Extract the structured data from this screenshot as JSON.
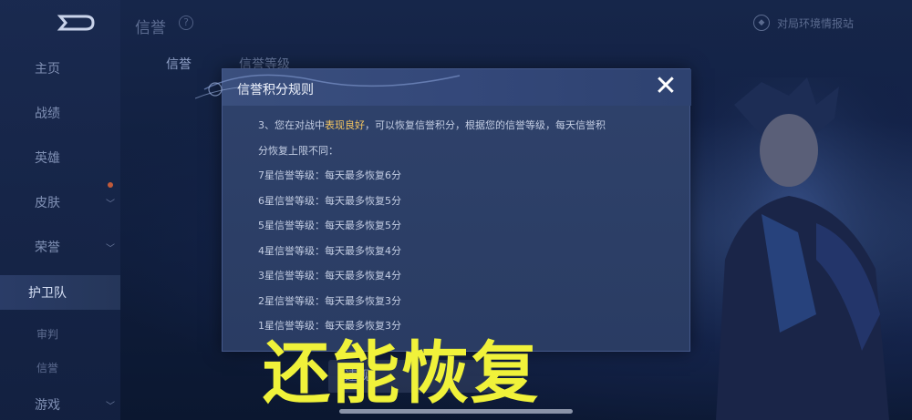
{
  "colors": {
    "accent_highlight": "#f5c660",
    "caption_yellow": "#f0f23a",
    "modal_bg": "#2f426b",
    "page_bg": "#0d1a33"
  },
  "sidebar": {
    "items": [
      {
        "label": "主页",
        "chevron": false,
        "active": false
      },
      {
        "label": "战绩",
        "chevron": false,
        "active": false
      },
      {
        "label": "英雄",
        "chevron": false,
        "active": false
      },
      {
        "label": "皮肤",
        "chevron": true,
        "active": false,
        "dot": true
      },
      {
        "label": "荣誉",
        "chevron": true,
        "active": false
      },
      {
        "label": "护卫队",
        "chevron": false,
        "active": true
      },
      {
        "label": "审判",
        "chevron": false,
        "active": false,
        "sub": true
      },
      {
        "label": "信誉",
        "chevron": false,
        "active": false,
        "sub": true
      },
      {
        "label": "游戏",
        "chevron": true,
        "active": false
      }
    ]
  },
  "header": {
    "title": "信誉",
    "help_icon": "question-circle-icon",
    "report_label": "对局环境情报站",
    "report_icon": "shield-badge-icon"
  },
  "tabs": [
    "信誉",
    "信誉等级"
  ],
  "modal": {
    "title": "信誉积分规则",
    "close_icon": "close-icon",
    "intro_before": "3、您在对战中",
    "intro_highlight": "表现良好",
    "intro_after": "，可以恢复信誉积分，根据您的信誉等级，每天信誉积",
    "intro_line2": "分恢复上限不同：",
    "rules": [
      "7星信誉等级：每天最多恢复6分",
      "6星信誉等级：每天最多恢复5分",
      "5星信誉等级：每天最多恢复5分",
      "4星信誉等级：每天最多恢复4分",
      "3星信誉等级：每天最多恢复4分",
      "2星信誉等级：每天最多恢复3分",
      "1星信誉等级：每天最多恢复3分"
    ]
  },
  "bottom_button": "违规",
  "caption": "还能恢复"
}
